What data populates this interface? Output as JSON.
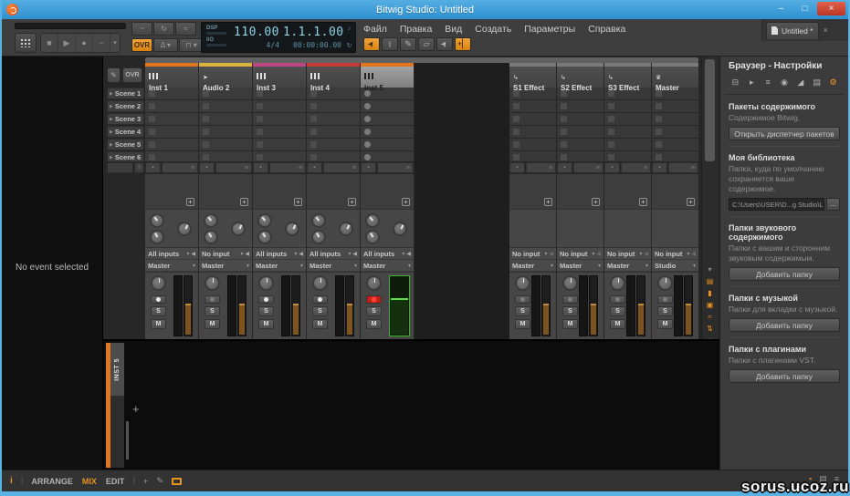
{
  "window": {
    "title": "Bitwig Studio: Untitled",
    "minimize": "–",
    "maximize": "□",
    "close": "×"
  },
  "menu": {
    "items": [
      "Файл",
      "Правка",
      "Вид",
      "Создать",
      "Параметры",
      "Справка"
    ]
  },
  "tab": {
    "label": "Untitled *",
    "close": "×"
  },
  "toolbar": {
    "tools": [
      {
        "name": "pointer-tool-icon",
        "glyph": "➤",
        "active": true,
        "rotate": true
      },
      {
        "name": "text-tool-icon",
        "glyph": "I",
        "active": false
      },
      {
        "name": "pencil-tool-icon",
        "glyph": "✎",
        "active": false
      },
      {
        "name": "eraser-tool-icon",
        "glyph": "▱",
        "active": false
      },
      {
        "name": "object-select-tool-icon",
        "glyph": "➤",
        "active": false,
        "rotate": true
      },
      {
        "name": "step-input-tool-icon",
        "glyph": "+▏",
        "active": true
      }
    ]
  },
  "transport": {
    "buttons": [
      {
        "name": "stop-button",
        "glyph": "■"
      },
      {
        "name": "play-button",
        "glyph": "▶"
      },
      {
        "name": "record-button",
        "glyph": "●"
      },
      {
        "name": "automation-write-button",
        "glyph": "~"
      },
      {
        "name": "transport-more-button",
        "glyph": "▾"
      }
    ],
    "row1": [
      {
        "name": "fill-mode-button",
        "glyph": "~"
      },
      {
        "name": "loop-button",
        "glyph": "↻"
      },
      {
        "name": "crossfade-button",
        "glyph": "≈"
      }
    ],
    "ovr_label": "OVR",
    "metronome_glyph": "Δ ▾",
    "punch_glyph": "⊓ ▾",
    "dsp_label": "DSP",
    "io_label": "I/O",
    "tempo": "110.00",
    "time_signature": "4/4",
    "position": "1.1.1.00",
    "time": "00:00:00.00",
    "note_icon_glyph": "♪",
    "groove_icon_glyph": "↻"
  },
  "inspector": {
    "empty_text": "No event selected"
  },
  "mixer": {
    "ovr_label": "OVR",
    "auto_glyph": "✎",
    "scenes": [
      "Scene 1",
      "Scene 2",
      "Scene 3",
      "Scene 4",
      "Scene 5",
      "Scene 6"
    ],
    "solo_label": "S",
    "mute_label": "M",
    "tracks": [
      {
        "name": "Inst 1",
        "type": "instrument",
        "color": "#e2761f",
        "input": "All inputs",
        "output": "Master",
        "selected": false,
        "record": false
      },
      {
        "name": "Audio 2",
        "type": "audio",
        "color": "#d9b33c",
        "input": "No input",
        "output": "Master",
        "selected": false,
        "record": false,
        "arm_dim": true
      },
      {
        "name": "Inst 3",
        "type": "instrument",
        "color": "#c04584",
        "input": "All inputs",
        "output": "Master",
        "selected": false,
        "record": false
      },
      {
        "name": "Inst 4",
        "type": "instrument",
        "color": "#c53a34",
        "input": "All inputs",
        "output": "Master",
        "selected": false,
        "record": false
      },
      {
        "name": "Inst 5",
        "type": "instrument",
        "color": "#e2761f",
        "input": "All inputs",
        "output": "Master",
        "selected": true,
        "record": true
      }
    ],
    "effect_tracks": [
      {
        "name": "S1 Effect",
        "type": "effect",
        "color": "#7a7a7a",
        "input": "No input",
        "output": "Master",
        "arm_dim": true
      },
      {
        "name": "S2 Effect",
        "type": "effect",
        "color": "#7a7a7a",
        "input": "No input",
        "output": "Master",
        "arm_dim": true
      },
      {
        "name": "S3 Effect",
        "type": "effect",
        "color": "#7a7a7a",
        "input": "No input",
        "output": "Master",
        "arm_dim": true
      },
      {
        "name": "Master",
        "type": "master",
        "color": "#7a7a7a",
        "input": "No input",
        "output": "Studio",
        "arm_dim": true
      }
    ],
    "section_icons": [
      {
        "name": "collapse-icon",
        "glyph": "▾",
        "dim": true
      },
      {
        "name": "clip-launcher-toggle-icon",
        "glyph": "▤"
      },
      {
        "name": "devices-toggle-icon",
        "glyph": "▮"
      },
      {
        "name": "sends-toggle-icon",
        "glyph": "▣"
      },
      {
        "name": "io-toggle-icon",
        "glyph": "≈"
      },
      {
        "name": "crossfade-toggle-icon",
        "glyph": "⇅"
      },
      {
        "name": "meters-toggle-icon",
        "glyph": "▾"
      }
    ]
  },
  "device_panel": {
    "track_label": "INST 5",
    "add_glyph": "+"
  },
  "browser_panel": {
    "title": "Браузер - Настройки",
    "icons": [
      {
        "name": "collections-icon",
        "glyph": "⊟",
        "active": false
      },
      {
        "name": "presets-icon",
        "glyph": "▸",
        "active": false
      },
      {
        "name": "devices-icon",
        "glyph": "≡",
        "active": false
      },
      {
        "name": "samples-icon",
        "glyph": "◉",
        "active": false
      },
      {
        "name": "multisamples-icon",
        "glyph": "◢",
        "active": false
      },
      {
        "name": "music-icon",
        "glyph": "▤",
        "active": false
      },
      {
        "name": "settings-icon",
        "glyph": "⚙",
        "active": true
      }
    ],
    "sections": [
      {
        "title": "Пакеты содержимого",
        "description": "Содержимое Bitwig.",
        "button": "Открыть диспетчер пакетов"
      },
      {
        "title": "Моя библиотека",
        "description": "Папка, куда по умолчанию сохраняется ваше содержимое.",
        "path": "C:\\Users\\USER\\D...g Studio\\Library",
        "browse": "..."
      },
      {
        "title": "Папки звукового содержимого",
        "description": "Папки с вашим и сторонним звуковым содержимым.",
        "button": "Добавить папку"
      },
      {
        "title": "Папки с музыкой",
        "description": "Папки для вкладки с музыкой.",
        "button": "Добавить папку"
      },
      {
        "title": "Папки с плагинами",
        "description": "Папки с плагинами VST.",
        "button": "Добавить папку"
      }
    ]
  },
  "status_bar": {
    "info": "i",
    "views": [
      "ARRANGE",
      "MIX",
      "EDIT"
    ],
    "active_view": "MIX",
    "left_icons": [
      {
        "name": "focus-icon",
        "glyph": "+"
      },
      {
        "name": "pen-mode-icon",
        "glyph": "✎"
      },
      {
        "name": "follow-playback-icon",
        "glyph": "",
        "box": true
      }
    ],
    "right_icons": [
      {
        "name": "notification-icon",
        "glyph": "▪",
        "orange": true
      },
      {
        "name": "file-status-icon",
        "glyph": "▤"
      },
      {
        "name": "engine-status-icon",
        "glyph": "≡"
      }
    ]
  },
  "watermark": "sorus.ucoz.ru",
  "colors": {
    "accent_orange": "#e8941f",
    "titlebar_blue": "#2f90d0",
    "record_red": "#c01f16",
    "meter_green": "#3db32d"
  }
}
